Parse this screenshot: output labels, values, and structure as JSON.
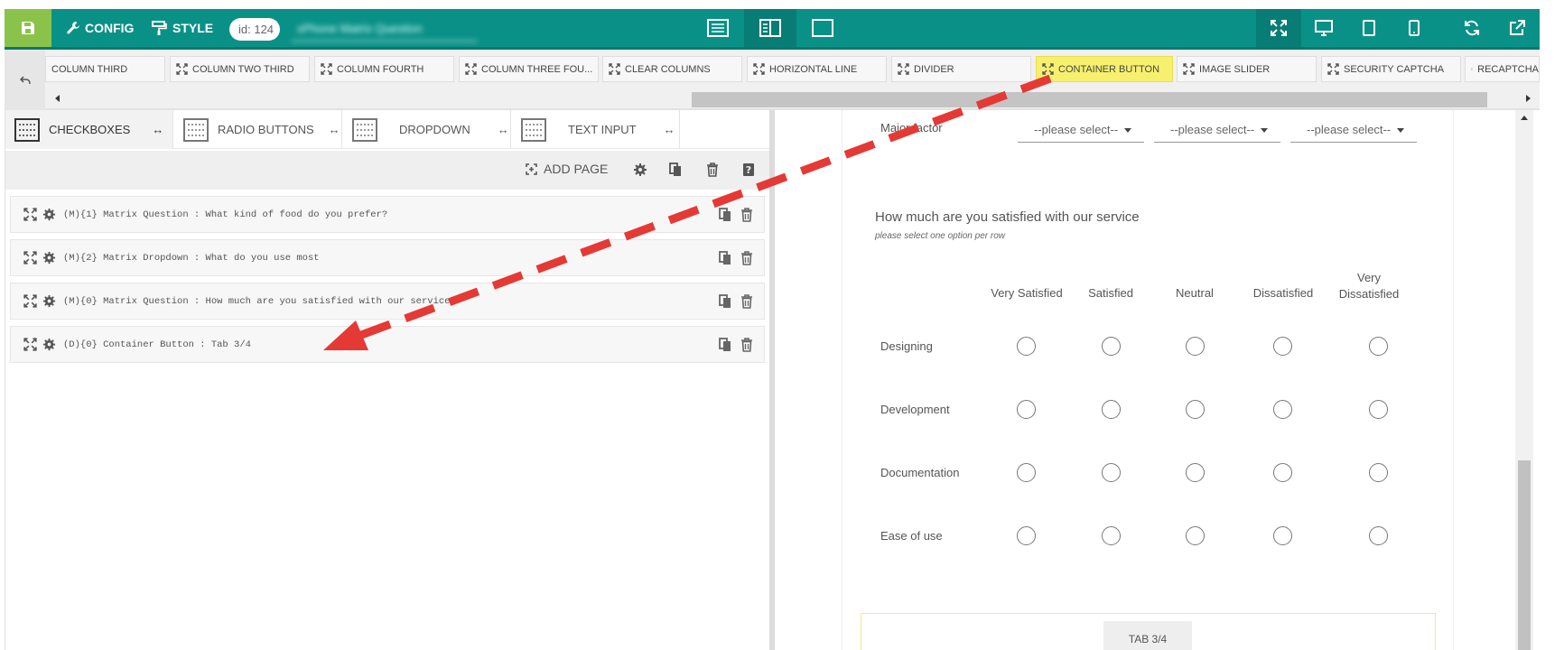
{
  "topbar": {
    "config_label": "CONFIG",
    "style_label": "STYLE",
    "id_label": "id: 124",
    "form_title": "xPhone Matrix Question"
  },
  "palette": {
    "items": [
      {
        "label": "COLUMN THIRD"
      },
      {
        "label": "COLUMN TWO THIRD"
      },
      {
        "label": "COLUMN FOURTH"
      },
      {
        "label": "COLUMN THREE FOU..."
      },
      {
        "label": "CLEAR COLUMNS"
      },
      {
        "label": "HORIZONTAL LINE"
      },
      {
        "label": "DIVIDER"
      },
      {
        "label": "CONTAINER BUTTON"
      },
      {
        "label": "IMAGE SLIDER"
      },
      {
        "label": "SECURITY CAPTCHA"
      },
      {
        "label": "RECAPTCHA"
      }
    ],
    "highlight_color": "#f7f06e"
  },
  "left_tabs": [
    {
      "label": "CHECKBOXES"
    },
    {
      "label": "RADIO BUTTONS"
    },
    {
      "label": "DROPDOWN"
    },
    {
      "label": "TEXT INPUT"
    }
  ],
  "toolbar": {
    "add_page_label": "ADD PAGE"
  },
  "fields": [
    {
      "label": "(M){1} Matrix Question : What kind of food do you prefer?"
    },
    {
      "label": "(M){2} Matrix Dropdown : What do you use most"
    },
    {
      "label": "(M){0} Matrix Question : How much are you satisfied with our service"
    },
    {
      "label": "(D){0} Container Button : Tab 3/4"
    }
  ],
  "preview": {
    "major_factor_label": "Major factor",
    "selects": [
      "--please select--",
      "--please select--",
      "--please select--"
    ],
    "question_title": "How much are you satisfied with our service",
    "question_subtitle": "please select one option per row",
    "columns": [
      "Very Satisfied",
      "Satisfied",
      "Neutral",
      "Dissatisfied",
      "Very Dissatisfied"
    ],
    "rows": [
      "Designing",
      "Development",
      "Documentation",
      "Ease of use"
    ],
    "tab_button_label": "TAB 3/4"
  },
  "colors": {
    "accent": "#0a9187",
    "save": "#8bc34a",
    "arrow": "#e53935"
  }
}
